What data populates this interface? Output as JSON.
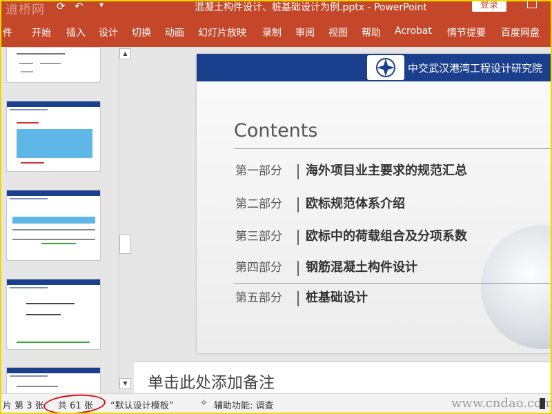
{
  "titlebar": {
    "watermark": "道桥网",
    "document_title": "混凝土构件设计、桩基础设计为例.pptx - PowerPoint",
    "login_label": "登录"
  },
  "ribbon": {
    "tabs": [
      "件",
      "开始",
      "插入",
      "设计",
      "切换",
      "动画",
      "幻灯片放映",
      "录制",
      "审阅",
      "视图",
      "帮助",
      "Acrobat",
      "情节提要",
      "百度网盘"
    ]
  },
  "slide": {
    "org_name": "中交武汉港湾工程设计研究院",
    "contents_title": "Contents",
    "rows": [
      {
        "part": "第一部分",
        "topic": "海外项目业主要求的规范汇总"
      },
      {
        "part": "第二部分",
        "topic": "欧标规范体系介绍"
      },
      {
        "part": "第三部分",
        "topic": "欧标中的荷载组合及分项系数"
      },
      {
        "part": "第四部分",
        "topic": "钢筋混凝土构件设计"
      },
      {
        "part": "第五部分",
        "topic": "桩基础设计"
      }
    ]
  },
  "notes": {
    "placeholder": "单击此处添加备注"
  },
  "statusbar": {
    "slide_pos": "片 第 3 张",
    "slide_total": "共 61 张",
    "template": "“默认设计模板”",
    "accessibility": "辅助功能: 调查",
    "site_watermark": "www.cndao.com"
  },
  "colors": {
    "ribbon": "#c4472a",
    "slide_header": "#1a3f8c",
    "highlight_ring": "#d01010",
    "frame": "#f2d600"
  }
}
